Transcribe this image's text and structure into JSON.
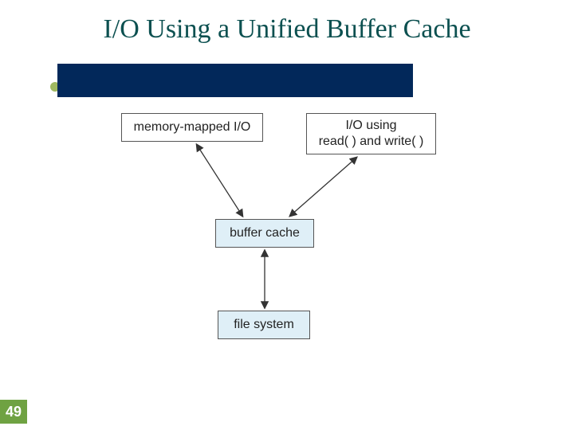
{
  "title": "I/O Using a Unified Buffer Cache",
  "page_number": "49",
  "diagram": {
    "boxes": {
      "mm_io": "memory-mapped I/O",
      "rw_io_line1": "I/O using",
      "rw_io_line2": "read( ) and write( )",
      "buffer_cache": "buffer cache",
      "file_system": "file system"
    },
    "edges": [
      {
        "from": "mm_io",
        "to": "buffer_cache",
        "bidirectional": true
      },
      {
        "from": "rw_io",
        "to": "buffer_cache",
        "bidirectional": true
      },
      {
        "from": "buffer_cache",
        "to": "file_system",
        "bidirectional": true
      }
    ]
  }
}
